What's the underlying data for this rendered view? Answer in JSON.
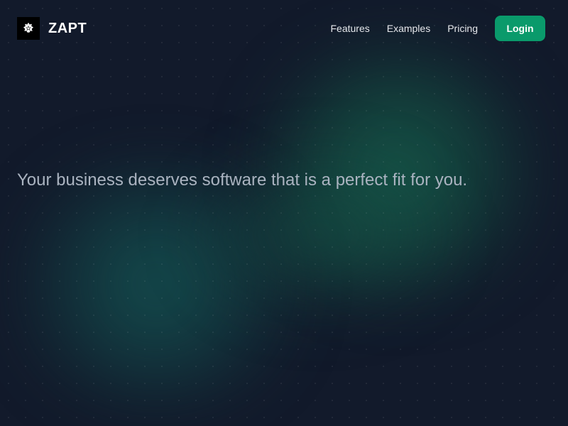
{
  "brand": {
    "name": "ZAPT",
    "logo_icon": "star-badge-icon"
  },
  "nav": {
    "links": [
      {
        "label": "Features"
      },
      {
        "label": "Examples"
      },
      {
        "label": "Pricing"
      }
    ],
    "login_label": "Login"
  },
  "hero": {
    "tagline": "Your business deserves software that is a perfect fit for you."
  },
  "colors": {
    "background": "#121a2b",
    "accent": "#0a9a6b",
    "glow_green": "#16624e",
    "glow_teal": "#145856",
    "tagline_text": "#aab3c0"
  }
}
